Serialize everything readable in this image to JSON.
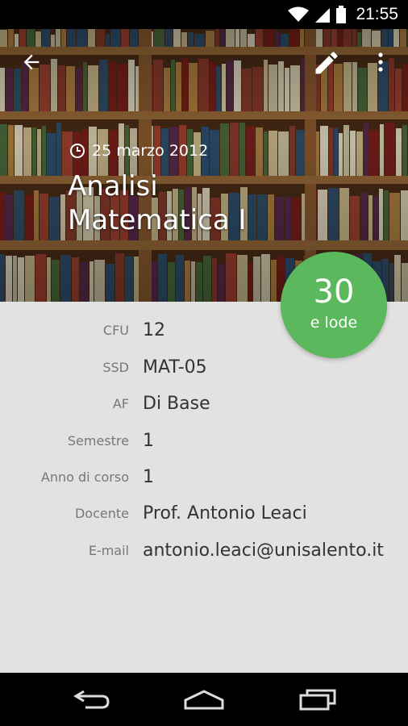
{
  "status_bar": {
    "time": "21:55"
  },
  "course": {
    "date": "25 marzo 2012",
    "title": "Analisi Matematica I"
  },
  "grade": {
    "score": "30",
    "honors": "e lode"
  },
  "details": [
    {
      "label": "CFU",
      "value": "12"
    },
    {
      "label": "SSD",
      "value": "MAT-05"
    },
    {
      "label": "AF",
      "value": "Di Base"
    },
    {
      "label": "Semestre",
      "value": "1"
    },
    {
      "label": "Anno di corso",
      "value": "1"
    },
    {
      "label": "Docente",
      "value": "Prof. Antonio Leaci"
    },
    {
      "label": "E-mail",
      "value": "antonio.leaci@unisalento.it"
    }
  ],
  "icons": {
    "back": "arrow-back-icon",
    "edit": "pencil-icon",
    "overflow": "more-vert-icon",
    "clock": "clock-icon"
  },
  "colors": {
    "grade_badge": "#5cb85c",
    "content_bg": "#e2e2e2",
    "label_text": "#777777",
    "value_text": "#333333"
  }
}
